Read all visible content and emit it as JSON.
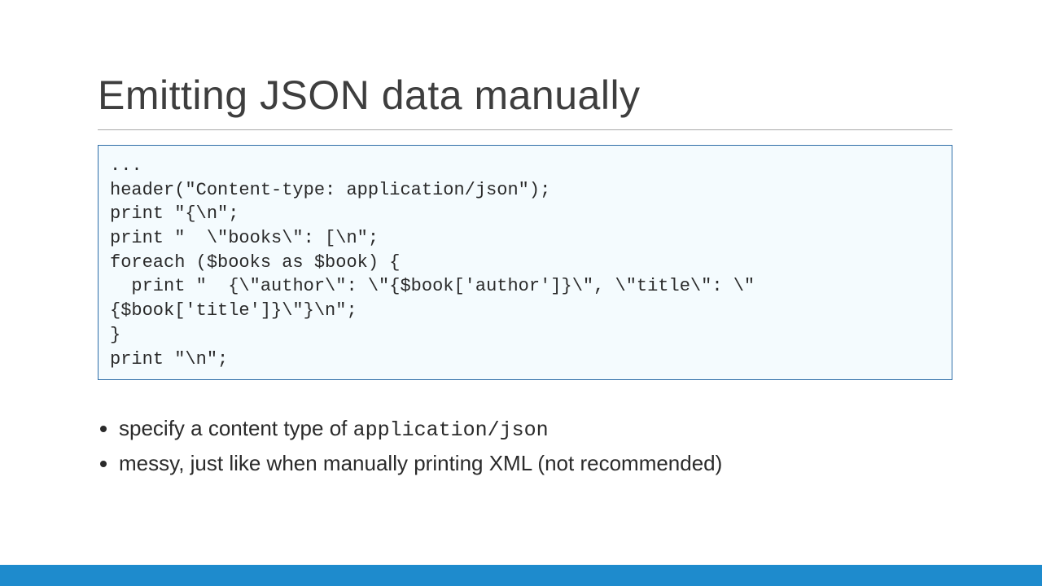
{
  "slide": {
    "title": "Emitting JSON data manually",
    "code": "...\nheader(\"Content-type: application/json\");\nprint \"{\\n\";\nprint \"  \\\"books\\\": [\\n\";\nforeach ($books as $book) {\n  print \"  {\\\"author\\\": \\\"{$book['author']}\\\", \\\"title\\\": \\\"{$book['title']}\\\"}\\n\";\n}\nprint \"\\n\";",
    "bullets": [
      {
        "pre": "specify a content type of ",
        "code": "application/json",
        "post": ""
      },
      {
        "pre": "messy, just like when manually printing XML (not recommended)",
        "code": "",
        "post": ""
      }
    ]
  }
}
